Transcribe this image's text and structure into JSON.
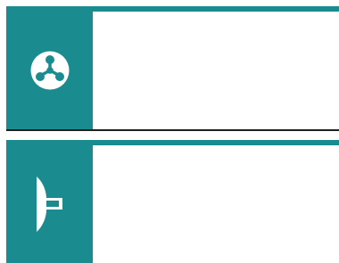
{
  "theme": {
    "accent": "#1a8c8f",
    "panel": "#ffffff",
    "border": "#1f1f1f"
  },
  "cards": [
    {
      "icon": "network-hub-icon",
      "text": ""
    },
    {
      "icon": "signpost-flag-icon",
      "text": ""
    }
  ]
}
